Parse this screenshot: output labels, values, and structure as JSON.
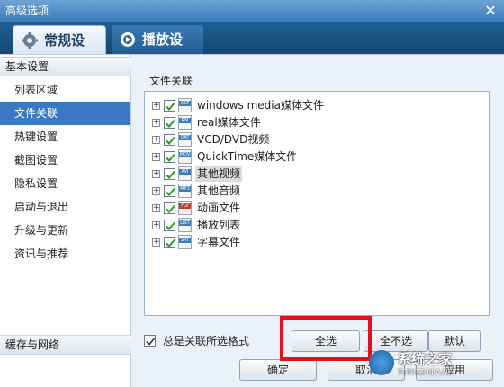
{
  "window": {
    "title": "高级选项"
  },
  "tabs": [
    {
      "label": "常规设置",
      "active": true
    },
    {
      "label": "播放设置",
      "active": false
    }
  ],
  "sidebar": {
    "header": "基本设置",
    "items": [
      {
        "label": "列表区域"
      },
      {
        "label": "文件关联",
        "active": true
      },
      {
        "label": "热键设置"
      },
      {
        "label": "截图设置"
      },
      {
        "label": "隐私设置"
      },
      {
        "label": "启动与退出"
      },
      {
        "label": "升级与更新"
      },
      {
        "label": "资讯与推荐"
      }
    ],
    "footer": "缓存与网络"
  },
  "file_assoc": {
    "title": "文件关联",
    "items": [
      {
        "label": "windows media媒体文件",
        "tag": "ASF",
        "checked": true
      },
      {
        "label": "real媒体文件",
        "tag": "RM",
        "checked": true
      },
      {
        "label": "VCD/DVD视频",
        "tag": "DAT",
        "checked": true
      },
      {
        "label": "QuickTime媒体文件",
        "tag": "MOV",
        "checked": true
      },
      {
        "label": "其他视频",
        "tag": "AVI",
        "checked": true,
        "selected": true
      },
      {
        "label": "其他音频",
        "tag": "MP3",
        "checked": true
      },
      {
        "label": "动画文件",
        "tag": "FLV",
        "checked": true
      },
      {
        "label": "播放列表",
        "tag": "LIST",
        "checked": true
      },
      {
        "label": "字幕文件",
        "tag": "SRT",
        "checked": true
      }
    ],
    "always_label": "总是关联所选格式",
    "always_checked": true
  },
  "buttons": {
    "select_all": "全选",
    "deselect": "全不选",
    "default": "默认",
    "ok": "确定",
    "cancel": "取消",
    "apply": "应用"
  },
  "watermark": {
    "text": "系统之家",
    "sub": "TONGZHIJIA.NET"
  },
  "colors": {
    "accent": "#3a78c4",
    "highlight": "#e2101c",
    "titlebar": "#3b7bb8"
  }
}
